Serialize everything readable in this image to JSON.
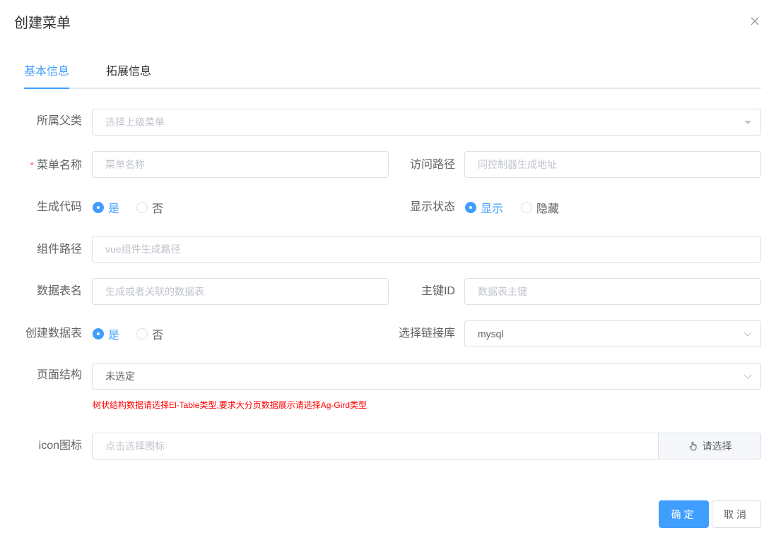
{
  "dialog": {
    "title": "创建菜单"
  },
  "tabs": [
    {
      "label": "基本信息"
    },
    {
      "label": "拓展信息"
    }
  ],
  "form": {
    "parent": {
      "label": "所属父类",
      "placeholder": "选择上级菜单"
    },
    "name": {
      "label": "菜单名称",
      "required_mark": "*",
      "placeholder": "菜单名称"
    },
    "path": {
      "label": "访问路径",
      "placeholder": "同控制器生成地址"
    },
    "gen_code": {
      "label": "生成代码",
      "options": [
        "是",
        "否"
      ],
      "selected": "是"
    },
    "show_status": {
      "label": "显示状态",
      "options": [
        "显示",
        "隐藏"
      ],
      "selected": "显示"
    },
    "component": {
      "label": "组件路径",
      "placeholder": "vue组件生成路径"
    },
    "table_name": {
      "label": "数据表名",
      "placeholder": "生成或者关联的数据表"
    },
    "primary_key": {
      "label": "主键ID",
      "placeholder": "数据表主键"
    },
    "create_table": {
      "label": "创建数据表",
      "options": [
        "是",
        "否"
      ],
      "selected": "是"
    },
    "db_link": {
      "label": "选择链接库",
      "value": "mysql"
    },
    "page_struct": {
      "label": "页面结构",
      "value": "未选定",
      "hint": "树状结构数据请选择El-Table类型,要求大分页数据展示请选择Ag-Gird类型"
    },
    "icon": {
      "label": "icon图标",
      "placeholder": "点击选择图标",
      "button": "请选择"
    }
  },
  "footer": {
    "confirm": "确定",
    "cancel": "取消"
  },
  "colors": {
    "primary": "#409eff",
    "border": "#dcdfe6",
    "placeholder": "#c0c4cc",
    "danger": "#ff0000"
  }
}
